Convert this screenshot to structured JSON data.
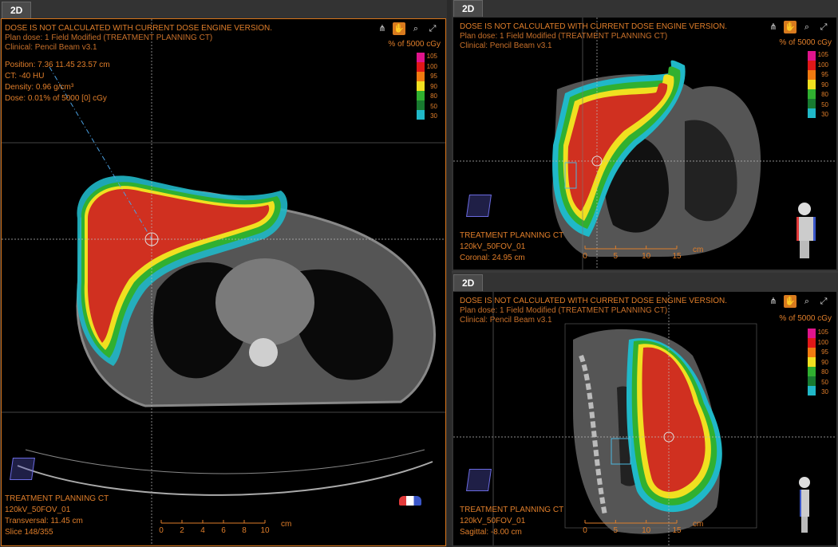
{
  "tabs": {
    "left": "2D",
    "topright": "2D",
    "bottomright": "2D"
  },
  "overlay": {
    "warning": "DOSE IS NOT CALCULATED WITH CURRENT DOSE ENGINE VERSION.",
    "plan_dose": "Plan dose: 1 Field Modified (TREATMENT PLANNING CT)",
    "clinical": "Clinical: Pencil Beam v3.1",
    "dose_unit": "% of 5000 cGy",
    "image_set": "TREATMENT PLANNING CT",
    "scan_protocol": "120kV_50FOV_01"
  },
  "cursor_info": {
    "position": "Position: 7.36 11.45 23.57 cm",
    "ct": "CT: -40 HU",
    "density": "Density: 0.96 g/cm³",
    "dose": "Dose: 0.01% of 5000 [0] cGy"
  },
  "views": {
    "transversal": {
      "plane": "Transversal: 11.45 cm",
      "slice": "Slice 148/355",
      "scale": [
        "0",
        "2",
        "4",
        "6",
        "8",
        "10"
      ],
      "scale_unit": "cm"
    },
    "coronal": {
      "plane": "Coronal: 24.95 cm",
      "scale": [
        "0",
        "5",
        "10",
        "15"
      ],
      "scale_unit": "cm"
    },
    "sagittal": {
      "plane": "Sagittal: -8.00 cm",
      "scale": [
        "0",
        "5",
        "10",
        "15"
      ],
      "scale_unit": "cm"
    }
  },
  "legend": {
    "levels": [
      "105",
      "100",
      "95",
      "90",
      "80",
      "50",
      "30"
    ],
    "colors": [
      "#e0148c",
      "#e01818",
      "#f07a10",
      "#f0e020",
      "#30b030",
      "#187a30",
      "#20b8c8"
    ]
  },
  "toolbar_icons": [
    "beam-icon",
    "pan-hand-icon",
    "zoom-icon",
    "fullscreen-icon"
  ]
}
